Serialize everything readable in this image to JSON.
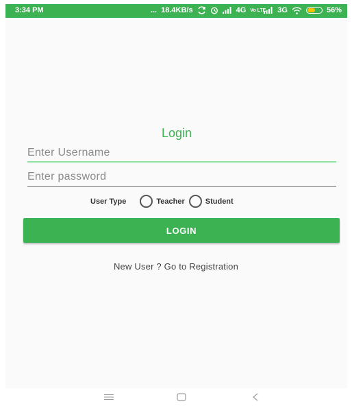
{
  "status_bar": {
    "time": "3:34 PM",
    "dots": "...",
    "network_speed": "18.4KB/s",
    "network_4g": "4G",
    "volte": "Vo LTE",
    "network_3g": "3G",
    "battery_percent": "56%",
    "battery_level": 0.56,
    "icons": [
      "sync-icon",
      "alarm-icon",
      "signal-icon",
      "signal-icon",
      "wifi-icon",
      "battery-icon"
    ],
    "color": "#3cb252"
  },
  "login": {
    "title": "Login",
    "username_placeholder": "Enter Username",
    "username_value": "",
    "password_placeholder": "Enter password",
    "password_value": "",
    "user_type_label": "User Type",
    "options": [
      {
        "label": "Teacher",
        "selected": false
      },
      {
        "label": "Student",
        "selected": false
      }
    ],
    "button_label": "LOGIN",
    "register_link": "New User ? Go to Registration",
    "accent_color": "#3cb252"
  },
  "nav_bar": {
    "icons": [
      "menu-icon",
      "home-icon",
      "back-icon"
    ]
  }
}
